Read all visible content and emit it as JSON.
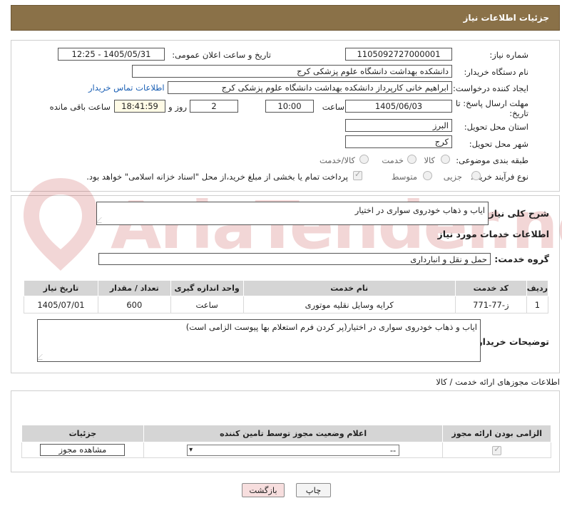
{
  "header": {
    "title": "جزئیات اطلاعات نیاز"
  },
  "need_number": {
    "label": "شماره نیاز:",
    "value": "1105092727000001"
  },
  "announce": {
    "label": "تاریخ و ساعت اعلان عمومی:",
    "value": "1405/05/31 - 12:25"
  },
  "buyer_org": {
    "label": "نام دستگاه خریدار:",
    "value": "دانشکده بهداشت دانشگاه علوم پزشکی کرج"
  },
  "requester": {
    "label": "ایجاد کننده درخواست:",
    "value": "ابراهیم خانی کارپرداز دانشکده بهداشت دانشگاه علوم پزشکی کرج",
    "contact_link": "اطلاعات تماس خریدار"
  },
  "deadline": {
    "label_line1": "مهلت ارسال پاسخ: تا",
    "label_line2": "تاریخ:",
    "date": "1405/06/03",
    "time_label": "ساعت",
    "time": "10:00",
    "days": "2",
    "days_label": "روز و",
    "remaining": "18:41:59",
    "remaining_label": "ساعت باقی مانده"
  },
  "province": {
    "label": "استان محل تحویل:",
    "value": "البرز"
  },
  "city": {
    "label": "شهر محل تحویل:",
    "value": "کرج"
  },
  "category": {
    "label": "طبقه بندی موضوعی:",
    "options": [
      "کالا",
      "خدمت",
      "کالا/خدمت"
    ]
  },
  "process": {
    "label": "نوع فرآیند خرید :",
    "options": [
      "جزیی",
      "متوسط"
    ],
    "payment_note": "پرداخت تمام یا بخشی از مبلغ خرید،از محل \"اسناد خزانه اسلامی\" خواهد بود."
  },
  "summary": {
    "label": "شرح کلی نیاز:",
    "value": "ایاب و ذهاب خودروی سواری در اختیار"
  },
  "services_title": "اطلاعات خدمات مورد نیاز",
  "service_group": {
    "label": "گروه خدمت:",
    "value": "حمل و نقل و انبارداری"
  },
  "services_table": {
    "headers": [
      "ردیف",
      "کد خدمت",
      "نام خدمت",
      "واحد اندازه گیری",
      "تعداد / مقدار",
      "تاریخ نیاز"
    ],
    "rows": [
      {
        "row": "1",
        "code": "ز-77-771",
        "name": "کرایه وسایل نقلیه موتوری",
        "unit": "ساعت",
        "qty": "600",
        "date": "1405/07/01"
      }
    ]
  },
  "buyer_notes": {
    "label": "توضیحات خریدار:",
    "value": "ایاب و ذهاب خودروی سواری در اختیار(پر کردن فرم استعلام بها پیوست الزامی است)"
  },
  "permits": {
    "title": "اطلاعات مجوزهای ارائه خدمت / کالا",
    "headers": [
      "الزامی بودن ارائه مجوز",
      "اعلام وضعیت مجوز توسط تامین کننده",
      "جزئیات"
    ],
    "select_value": "--",
    "view_button": "مشاهده مجوز"
  },
  "buttons": {
    "print": "چاپ",
    "back": "بازگشت"
  },
  "watermark": {
    "text": "AriaTender.net"
  },
  "colors": {
    "header": "#8a7148",
    "link": "#1a5fb4",
    "back_button": "#f7dede"
  }
}
